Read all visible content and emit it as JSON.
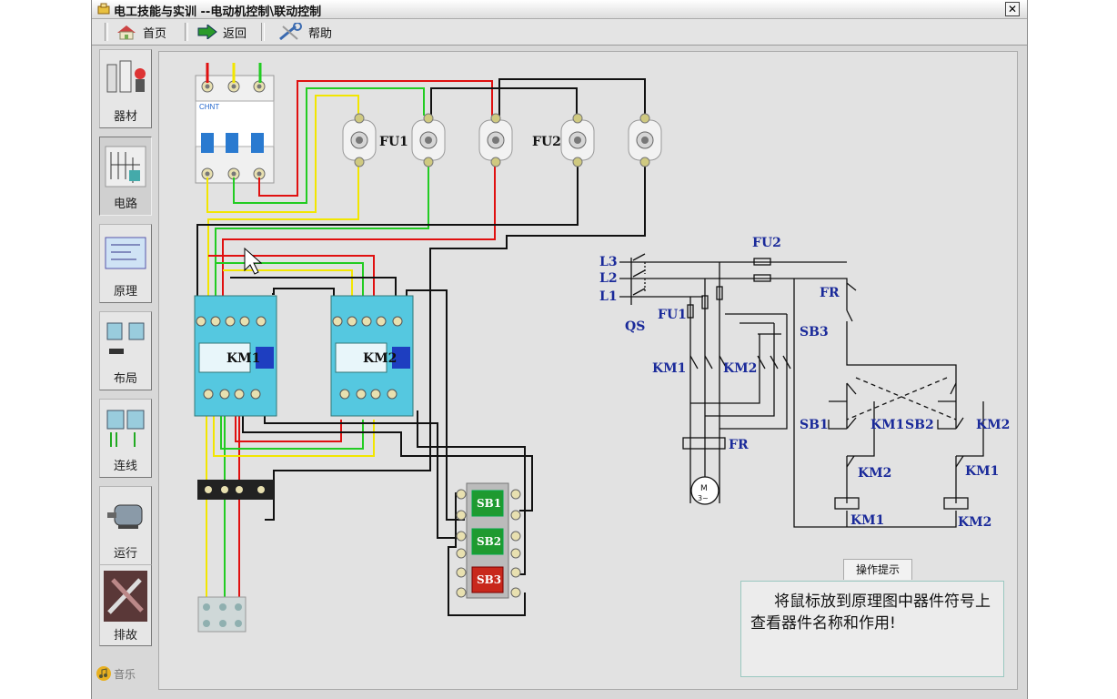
{
  "window": {
    "title": "电工技能与实训 --电动机控制\\联动控制",
    "close_glyph": "✕"
  },
  "toolbar": {
    "home": "首页",
    "back": "返回",
    "help": "帮助"
  },
  "sidebar": {
    "items": [
      {
        "label": "器材"
      },
      {
        "label": "电路"
      },
      {
        "label": "原理"
      },
      {
        "label": "布局"
      },
      {
        "label": "连线"
      },
      {
        "label": "运行"
      },
      {
        "label": "排故"
      }
    ],
    "music": "音乐"
  },
  "wiring": {
    "fu1": "FU1",
    "fu2": "FU2",
    "km1": "KM1",
    "km2": "KM2",
    "sb1": "SB1",
    "sb2": "SB2",
    "sb3": "SB3",
    "breaker_brand": "CHNT"
  },
  "schematic": {
    "l3": "L3",
    "l2": "L2",
    "l1": "L1",
    "qs": "QS",
    "fu1": "FU1",
    "fu2": "FU2",
    "fr_top": "FR",
    "fr_main": "FR",
    "km1_main": "KM1",
    "km2_main": "KM2",
    "sb3": "SB3",
    "sb1": "SB1",
    "km1_hold": "KM1",
    "sb2": "SB2",
    "km2_hold": "KM2",
    "km2_interlock": "KM2",
    "km1_interlock": "KM1",
    "km1_coil": "KM1",
    "km2_coil": "KM2",
    "motor": "M",
    "motor_phase": "3~"
  },
  "hint": {
    "tab": "操作提示",
    "text": "将鼠标放到原理图中器件符号上查看器件名称和作用!"
  },
  "colors": {
    "wire_red": "#e01010",
    "wire_yellow": "#f2e600",
    "wire_green": "#22cc22",
    "wire_black": "#111111",
    "label_blue": "#1a2a9a"
  }
}
